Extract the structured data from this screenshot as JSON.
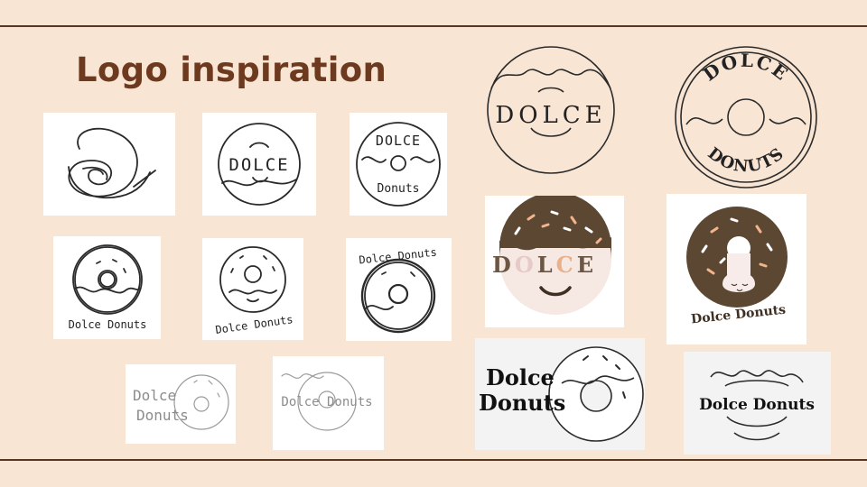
{
  "slide": {
    "title": "Logo inspiration",
    "colors": {
      "background": "#f8e5d4",
      "title": "#6e3a1f",
      "rule": "#5a3520",
      "chocolate": "#5c4733",
      "dough": "#f6e8e2"
    }
  },
  "sketches": {
    "s2_word": "DOLCE",
    "s3_top": "DOLCE",
    "s3_bottom": "Donuts",
    "s4_label": "Dolce Donuts",
    "s5_label": "Dolce Donuts",
    "s6_top": "Dolce Donuts",
    "s7_line1": "Dolce",
    "s7_line2": "Donuts",
    "s8_label": "Dolce Donuts"
  },
  "logos": {
    "l1_word": "DOLCE",
    "l2_top": "DOLCE",
    "l2_bottom": "DONUTS",
    "l3_letters": [
      "D",
      "O",
      "L",
      "C",
      "E"
    ],
    "l4_label": "Dolce Donuts",
    "l5_line1": "Dolce",
    "l5_line2": "Donuts",
    "l6_label": "Dolce Donuts"
  }
}
